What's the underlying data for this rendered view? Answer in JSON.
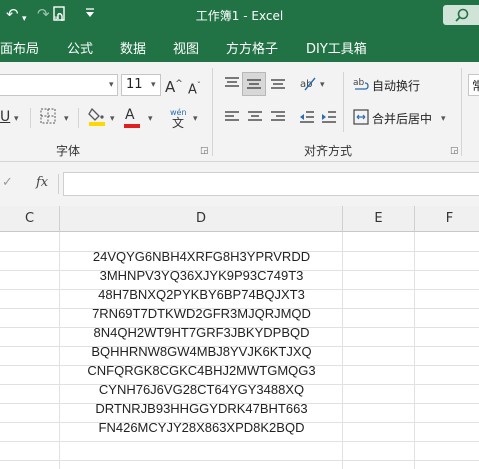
{
  "window": {
    "title": "工作簿1  -  Excel"
  },
  "quick_access": {
    "undo_icon": "undo-icon",
    "redo_icon": "redo-icon",
    "touch_icon": "touch-mode-icon",
    "customize_icon": "customize-icon"
  },
  "tabs": [
    {
      "label": "面布局"
    },
    {
      "label": "公式"
    },
    {
      "label": "数据"
    },
    {
      "label": "视图"
    },
    {
      "label": "方方格子"
    },
    {
      "label": "DIY工具箱"
    }
  ],
  "font_group": {
    "label": "字体",
    "font_size": "11",
    "grow_label": "A",
    "shrink_label": "A",
    "underline_label": "U",
    "font_color_label": "A",
    "phonetic_label": "wén",
    "colors": {
      "fill": "#ffd800",
      "font": "#e02020"
    }
  },
  "align_group": {
    "label": "对齐方式",
    "wrap_text": "自动换行",
    "merge_center": "合并后居中"
  },
  "number_group": {
    "format_partial": "常"
  },
  "formula_bar": {
    "fx": "fx",
    "check": "✓"
  },
  "columns": [
    "C",
    "D",
    "E",
    "F"
  ],
  "cells_D": [
    "24VQYG6NBH4XRFG8H3YPRVRDD",
    "3MHNPV3YQ36XJYK9P93C749T3",
    "48H7BNXQ2PYKBY6BP74BQJXT3",
    "7RN69T7DTKWD2GFR3MJQRJMQD",
    "8N4QH2WT9HT7GRF3JBKYDPBQD",
    "BQHHRNW8GW4MBJ8YVJK6KTJXQ",
    "CNFQRGK8CGKC4BHJ2MWTGMQG3",
    "CYNH76J6VG28CT64YGY3488XQ",
    "DRTNRJB93HHGGYDRK47BHT663",
    "FN426MCYJY28X863XPD8K2BQD"
  ]
}
